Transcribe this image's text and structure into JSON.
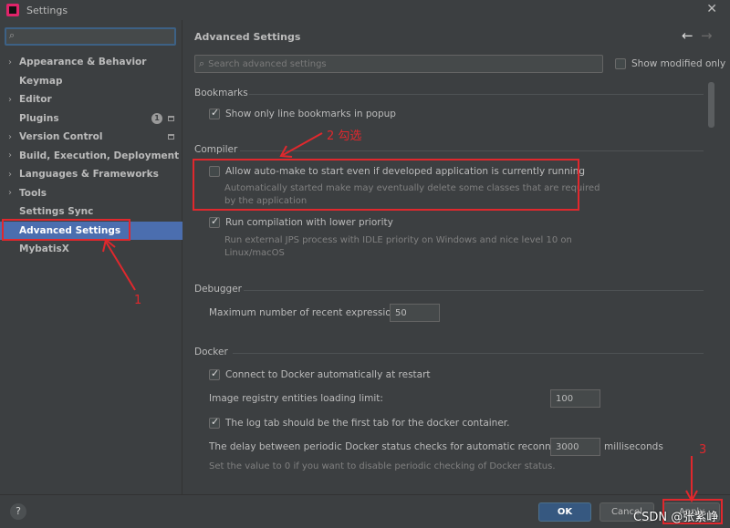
{
  "window": {
    "title": "Settings"
  },
  "sidebar": {
    "items": [
      {
        "label": "Appearance & Behavior",
        "expandable": true
      },
      {
        "label": "Keymap",
        "expandable": false
      },
      {
        "label": "Editor",
        "expandable": true
      },
      {
        "label": "Plugins",
        "expandable": false,
        "badge": "1"
      },
      {
        "label": "Version Control",
        "expandable": true
      },
      {
        "label": "Build, Execution, Deployment",
        "expandable": true
      },
      {
        "label": "Languages & Frameworks",
        "expandable": true
      },
      {
        "label": "Tools",
        "expandable": true
      },
      {
        "label": "Settings Sync",
        "expandable": false
      },
      {
        "label": "Advanced Settings",
        "expandable": false,
        "selected": true
      },
      {
        "label": "MybatisX",
        "expandable": false
      }
    ]
  },
  "main": {
    "title": "Advanced Settings",
    "search_placeholder": "Search advanced settings",
    "show_modified_label": "Show modified only",
    "bookmarks": {
      "header": "Bookmarks",
      "show_line_bookmarks": "Show only line bookmarks in popup"
    },
    "compiler": {
      "header": "Compiler",
      "auto_make_label": "Allow auto-make to start even if developed application is currently running",
      "auto_make_desc_1": "Automatically started make may eventually delete some classes that are required",
      "auto_make_desc_2": "by the application",
      "low_priority_label": "Run compilation with lower priority",
      "low_priority_desc_1": "Run external JPS process with IDLE priority on Windows and nice level 10 on",
      "low_priority_desc_2": "Linux/macOS"
    },
    "debugger": {
      "header": "Debugger",
      "max_expr_label": "Maximum number of recent expressions:",
      "max_expr_value": "50"
    },
    "docker": {
      "header": "Docker",
      "connect_label": "Connect to Docker automatically at restart",
      "registry_label": "Image registry entities loading limit:",
      "registry_value": "100",
      "log_tab_label": "The log tab should be the first tab for the docker container.",
      "delay_label": "The delay between periodic Docker status checks for automatic reconnection:",
      "delay_value": "3000",
      "delay_unit": "milliseconds",
      "delay_desc": "Set the value to 0 if you want to disable periodic checking of Docker status."
    }
  },
  "footer": {
    "help": "?",
    "ok": "OK",
    "cancel": "Cancel",
    "apply": "Apply"
  },
  "annotations": {
    "step1": "1",
    "step2": "2 勾选",
    "step3": "3",
    "color": "#e0282d"
  },
  "watermark": "CSDN @张紫峥"
}
